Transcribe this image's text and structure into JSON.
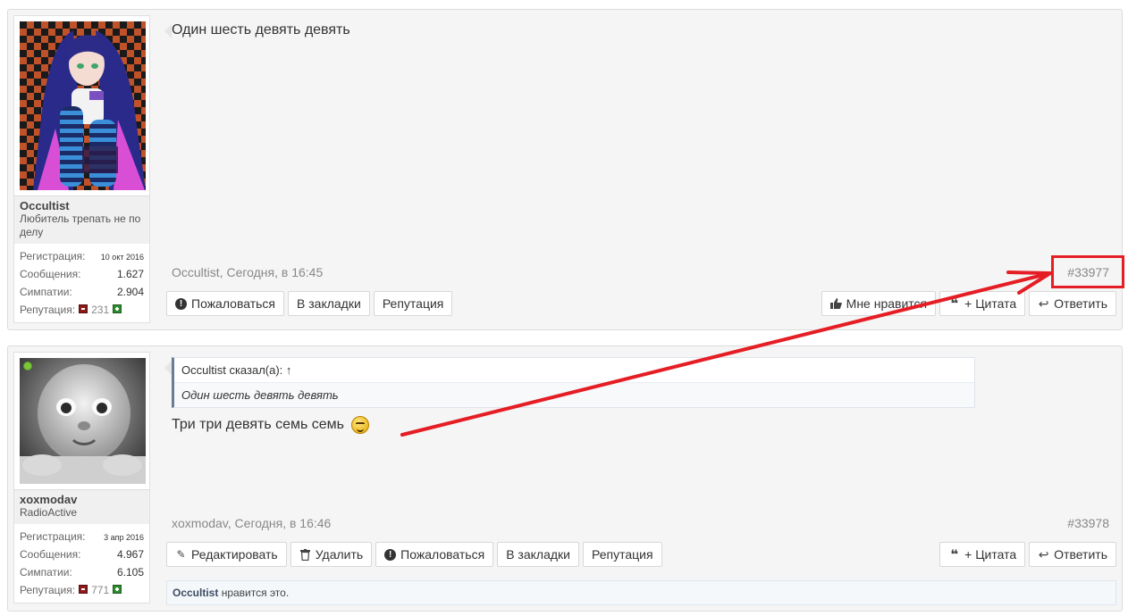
{
  "posts": [
    {
      "user": {
        "name": "Occultist",
        "title": "Любитель трепать не по делу",
        "stats": {
          "registration_label": "Регистрация:",
          "registration_value": "10 окт 2016",
          "messages_label": "Сообщения:",
          "messages_value": "1.627",
          "likes_label": "Симпатии:",
          "likes_value": "2.904",
          "reputation_label": "Репутация:",
          "reputation_value": "231"
        }
      },
      "message": "Один шесть девять девять",
      "meta_author": "Occultist, Сегодня, в 16:45",
      "post_number": "#33977",
      "left_buttons": [
        "Пожаловаться",
        "В закладки",
        "Репутация"
      ],
      "right_buttons": [
        "Мне нравится",
        "+ Цитата",
        "Ответить"
      ]
    },
    {
      "user": {
        "name": "xoxmodav",
        "title": "RadioActive",
        "stats": {
          "registration_label": "Регистрация:",
          "registration_value": "3 апр 2016",
          "messages_label": "Сообщения:",
          "messages_value": "4.967",
          "likes_label": "Симпатии:",
          "likes_value": "6.105",
          "reputation_label": "Репутация:",
          "reputation_value": "771"
        }
      },
      "quote_head": "Occultist сказал(а): ↑",
      "quote_body": "Один шесть девять девять",
      "message": "Три три девять семь семь",
      "meta_author": "xoxmodav, Сегодня, в 16:46",
      "post_number": "#33978",
      "left_buttons": [
        "Редактировать",
        "Удалить",
        "Пожаловаться",
        "В закладки",
        "Репутация"
      ],
      "right_buttons": [
        "+ Цитата",
        "Ответить"
      ],
      "likes_user": "Occultist",
      "likes_text": " нравится это."
    }
  ],
  "colors": {
    "annotation": "#e51d24",
    "online": "#7cc63b"
  }
}
